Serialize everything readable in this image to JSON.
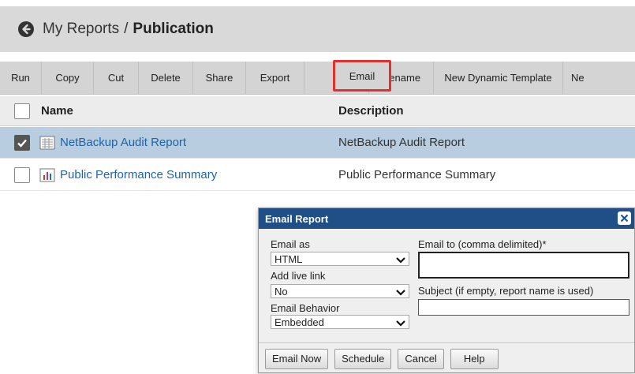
{
  "breadcrumb": {
    "root": "My Reports",
    "sep": "/",
    "current": "Publication"
  },
  "toolbar": {
    "buttons": [
      "Run",
      "Copy",
      "Cut",
      "Delete",
      "Share",
      "Export",
      "Email",
      "Rename",
      "New Dynamic Template",
      "Ne"
    ]
  },
  "list": {
    "col_name": "Name",
    "col_desc": "Description",
    "rows": [
      {
        "name": "NetBackup Audit Report",
        "desc": "NetBackup Audit Report",
        "checked": true,
        "icon": "table-report-icon"
      },
      {
        "name": "Public Performance Summary",
        "desc": "Public Performance Summary",
        "checked": false,
        "icon": "bar-chart-report-icon"
      }
    ]
  },
  "dialog": {
    "title": "Email Report",
    "email_as_label": "Email as",
    "email_as_value": "HTML",
    "live_link_label": "Add live link",
    "live_link_value": "No",
    "behavior_label": "Email Behavior",
    "behavior_value": "Embedded",
    "email_to_label": "Email to (comma delimited)*",
    "email_to_value": "",
    "subject_label": "Subject (if empty, report name is used)",
    "subject_value": "",
    "buttons": {
      "email_now": "Email Now",
      "schedule": "Schedule",
      "cancel": "Cancel",
      "help": "Help"
    }
  },
  "colors": {
    "dialog_title_bg": "#1f4f86",
    "selected_row": "#b8cde0",
    "link": "#1d64a8",
    "highlight": "#e03131"
  }
}
